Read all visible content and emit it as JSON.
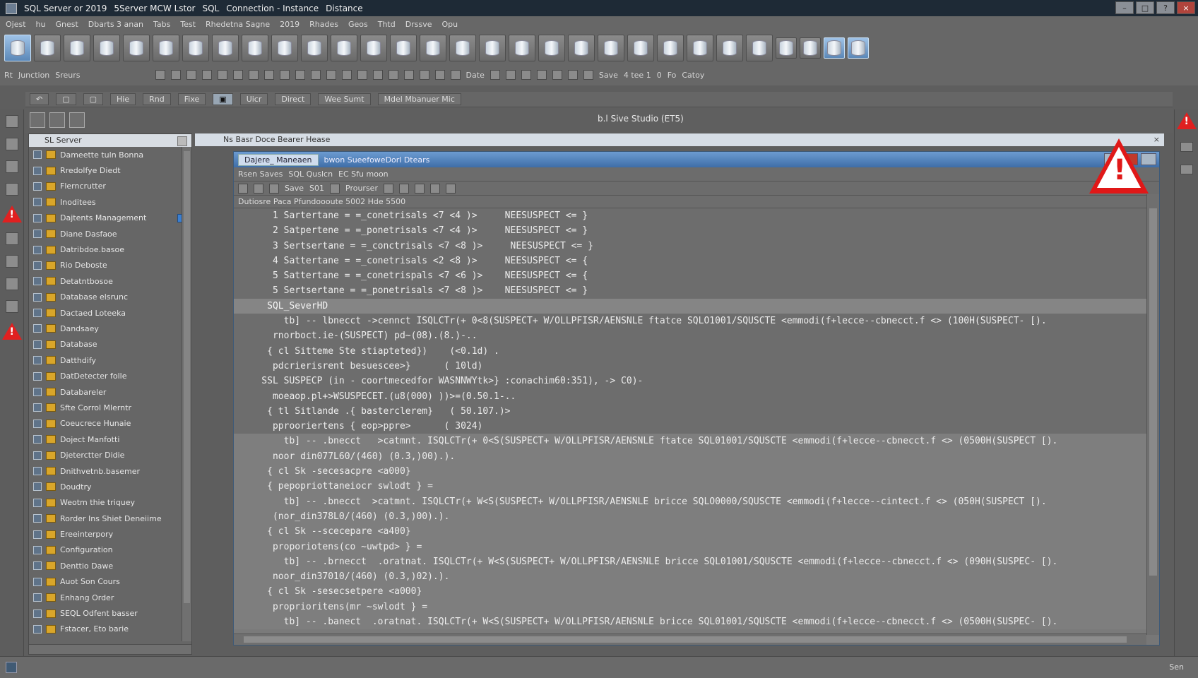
{
  "titlebar": {
    "items": [
      "SQL Server or 2019",
      "5Server MCW Lstor",
      "SQL",
      "Connection - Instance",
      "Distance"
    ]
  },
  "menubar": {
    "items": [
      "Ojest",
      "hu",
      "Gnest",
      "Dbarts 3 anan",
      "Tabs",
      "Test",
      "Rhedetna Sagne",
      "2019",
      "Rhades",
      "Geos",
      "Thtd",
      "Drssve",
      "Opu"
    ]
  },
  "toolbar2": {
    "left": [
      "Rt",
      "Junction",
      "Sreurs"
    ],
    "right": [
      "Date",
      "Save",
      "4 tee 1",
      "0",
      "Fo",
      "Catoy"
    ]
  },
  "toolbar3": {
    "items": [
      "Hie",
      "Rnd",
      "Fixe",
      "Uicr",
      "Direct",
      "Wee Sumt",
      "Mdel Mbanuer Mic"
    ]
  },
  "substrip": {
    "studio": "b.l Sive Studio",
    "instance": "(ET5)"
  },
  "explorer": {
    "header": "SL Server",
    "items": [
      {
        "label": "Dameette tuln Bonna"
      },
      {
        "label": "Rredolfye Diedt"
      },
      {
        "label": "Flerncrutter"
      },
      {
        "label": "Inoditees"
      },
      {
        "label": "Dajtents Management",
        "badge": true
      },
      {
        "label": "Diane Dasfaoe"
      },
      {
        "label": "Datribdoe.basoe"
      },
      {
        "label": "Rio Deboste"
      },
      {
        "label": "Detatntbosoe"
      },
      {
        "label": "Database elsrunc"
      },
      {
        "label": "Dactaed Loteeka"
      },
      {
        "label": "Dandsaey"
      },
      {
        "label": "Database"
      },
      {
        "label": "Datthdify"
      },
      {
        "label": "DatDetecter folle"
      },
      {
        "label": "Databareler"
      },
      {
        "label": "Sfte Corrol Mlerntr"
      },
      {
        "label": "Coeucrece Hunaie"
      },
      {
        "label": "Doject Manfotti"
      },
      {
        "label": "Djeterctter Didie"
      },
      {
        "label": "Dnithvetnb.basemer"
      },
      {
        "label": "Doudtry"
      },
      {
        "label": "Weotm thie triquey"
      },
      {
        "label": "Rorder Ins Shiet Deneiime"
      },
      {
        "label": "Ereeinterpory"
      },
      {
        "label": "Configuration"
      },
      {
        "label": "Denttio Dawe"
      },
      {
        "label": "Auot Son Cours"
      },
      {
        "label": "Enhang Order"
      },
      {
        "label": "SEQL Odfent basser"
      },
      {
        "label": "Fstacer, Eto barie"
      }
    ]
  },
  "mainhead": {
    "title": "Ns Basr Doce Bearer Hease"
  },
  "docwin": {
    "tab": "Dajere_ Maneaen",
    "title": "bwon SueefoweDorl Dtears",
    "bar1": [
      "Rsen Saves",
      "SQL Quslcn",
      "EC Sfu moon"
    ],
    "bar2": [
      "Save",
      "S01",
      "Prourser"
    ],
    "bar3": "Dutiosre Paca Pfundoooute 5002 Hde 5500"
  },
  "code": {
    "lines": [
      {
        "t": "      1 Sartertane = =_conetrisals <7 <4 )>     NEESUSPECT <= }",
        "c": "dark"
      },
      {
        "t": "      2 Satpertene = =_ponetrisals <7 <4 )>     NEESUSPECT <= }",
        "c": "dark"
      },
      {
        "t": "      3 Sertsertane = =_conctrisals <7 <8 )>     NEESUSPECT <= }",
        "c": "dark"
      },
      {
        "t": "      4 Sattertane = =_conetrisals <2 <8 )>     NEESUSPECT <= {",
        "c": "dark"
      },
      {
        "t": "      5 Sattertane = =_conetrispals <7 <6 )>    NEESUSPECT <= {",
        "c": "dark"
      },
      {
        "t": "      5 Sertsertane = =_ponetrisals <7 <8 )>    NEESUSPECT <= }",
        "c": "dark"
      },
      {
        "t": "     SQL_SeverHD",
        "c": "mid"
      },
      {
        "t": "        tb] -- lbnecct ->cennct ISQLCTr(+ 0<8(SUSPECT+ W/OLLPFISR/AENSNLE ftatce SQLO1001/SQUSCTE <emmodi(f+lecce--cbnecct.f <> (100H(SUSPECT- [).",
        "c": "dark"
      },
      {
        "t": "      rnorboct.ie-(SUSPECT) pd~(08).(8.)-..",
        "c": "dark"
      },
      {
        "t": "     { cl Sitteme Ste stiapteted})    (<0.1d) .",
        "c": "dark"
      },
      {
        "t": "      pdcrierisrent besuescee>}      ( 10ld)",
        "c": "dark"
      },
      {
        "t": "    SSL SUSPECP (in - coortmecedfor WASNNWYtk>} :conachim60:351), -> C0)-",
        "c": "dark"
      },
      {
        "t": "      moeaop.pl+>WSUSPECET.(u8(000) ))>=(0.50.1-..",
        "c": "dark"
      },
      {
        "t": "     { tl Sitlande .{ basterclerem}   ( 50.107.)>",
        "c": "dark"
      },
      {
        "t": "      pprooriertens { eop>ppre>      ( 3024)",
        "c": "dark"
      },
      {
        "t": "        tb] -- .bnecct   >catmnt. ISQLCTr(+ 0<S(SUSPECT+ W/OLLPFISR/AENSNLE ftatce SQL01001/SQUSCTE <emmodi(f+lecce--cbnecct.f <> (0500H(SUSPECT [).",
        "c": "light"
      },
      {
        "t": "      noor din077L60/(460) (0.3,)00).).",
        "c": "light"
      },
      {
        "t": "     { cl Sk -secesacpre <a000}",
        "c": "light"
      },
      {
        "t": "     { pepopriottaneiocr swlodt } =",
        "c": "light"
      },
      {
        "t": "        tb] -- .bnecct  >catmnt. ISQLCTr(+ W<S(SUSPECT+ W/OLLPFISR/AENSNLE bricce SQLO0000/SQUSCTE <emmodi(f+lecce--cintect.f <> (050H(SUSPECT [).",
        "c": "light"
      },
      {
        "t": "      (nor_din378L0/(460) (0.3,)00).).",
        "c": "light"
      },
      {
        "t": "     { cl Sk --scecepare <a400}",
        "c": "light"
      },
      {
        "t": "      proporiotens(co ~uwtpd> } =",
        "c": "light"
      },
      {
        "t": "        tb] -- .brnecct  .oratnat. ISQLCTr(+ W<S(SUSPECT+ W/OLLPFISR/AENSNLE bricce SQL01001/SQUSCTE <emmodi(f+lecce--cbnecct.f <> (090H(SUSPEC- [).",
        "c": "light"
      },
      {
        "t": "      noor_din37010/(460) (0.3,)02).).",
        "c": "light"
      },
      {
        "t": "     { cl Sk -sesecsetpere <a000}",
        "c": "light"
      },
      {
        "t": "      proprioritens(mr ~swlodt } =",
        "c": "light"
      },
      {
        "t": "        tb] -- .banect  .oratnat. ISQLCTr(+ W<S(SUSPECT+ W/OLLPFISR/AENSNLE bricce SQL01001/SQUSCTE <emmodi(f+lecce--cbnecct.f <> (0500H(SUSPEC- [).",
        "c": "light"
      }
    ]
  },
  "statusbar": {
    "right": "Sen"
  }
}
